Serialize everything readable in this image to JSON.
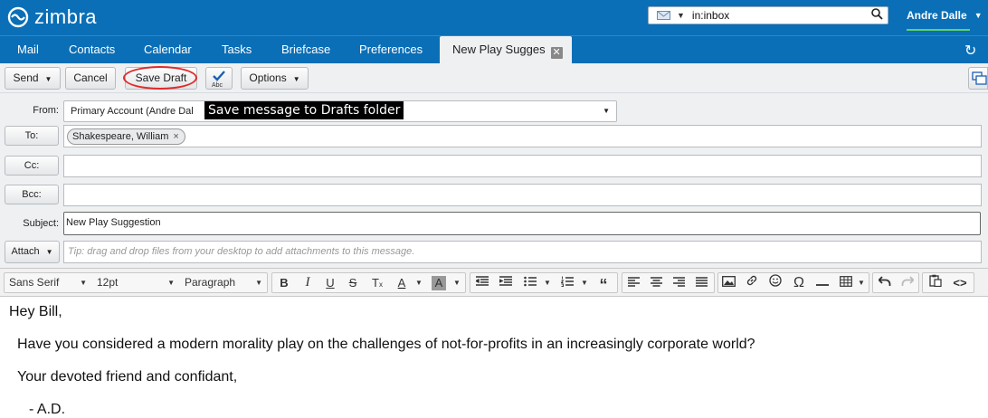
{
  "app": {
    "logo_text": "zimbra"
  },
  "search": {
    "query": "in:inbox"
  },
  "user": {
    "name": "Andre Dalle"
  },
  "tabs": [
    {
      "label": "Mail"
    },
    {
      "label": "Contacts"
    },
    {
      "label": "Calendar"
    },
    {
      "label": "Tasks"
    },
    {
      "label": "Briefcase"
    },
    {
      "label": "Preferences"
    },
    {
      "label": "New Play Sugges",
      "active": true
    }
  ],
  "toolbar": {
    "send_label": "Send",
    "cancel_label": "Cancel",
    "save_draft_label": "Save Draft",
    "spell_label": "Abc",
    "options_label": "Options"
  },
  "tooltip": {
    "text": "Save message to Drafts folder"
  },
  "compose": {
    "from_label": "From:",
    "from_value": "Primary Account (Andre Dal",
    "to_label": "To:",
    "to_recipients": [
      "Shakespeare, William"
    ],
    "cc_label": "Cc:",
    "bcc_label": "Bcc:",
    "subject_label": "Subject:",
    "subject_value": "New Play Suggestion",
    "attach_label": "Attach",
    "attach_tip": "Tip: drag and drop files from your desktop to add attachments to this message."
  },
  "editor": {
    "font_family": "Sans Serif",
    "font_size": "12pt",
    "block_format": "Paragraph"
  },
  "message": {
    "lines": [
      "Hey Bill,",
      "Have you considered a modern morality play on the challenges of not-for-profits in an increasingly corporate world?",
      "Your devoted friend and confidant,",
      "- A.D."
    ]
  },
  "colors": {
    "header_blue": "#0a6fb7",
    "highlight_red": "#e02b2b",
    "user_underline_green": "#5fd36b"
  }
}
